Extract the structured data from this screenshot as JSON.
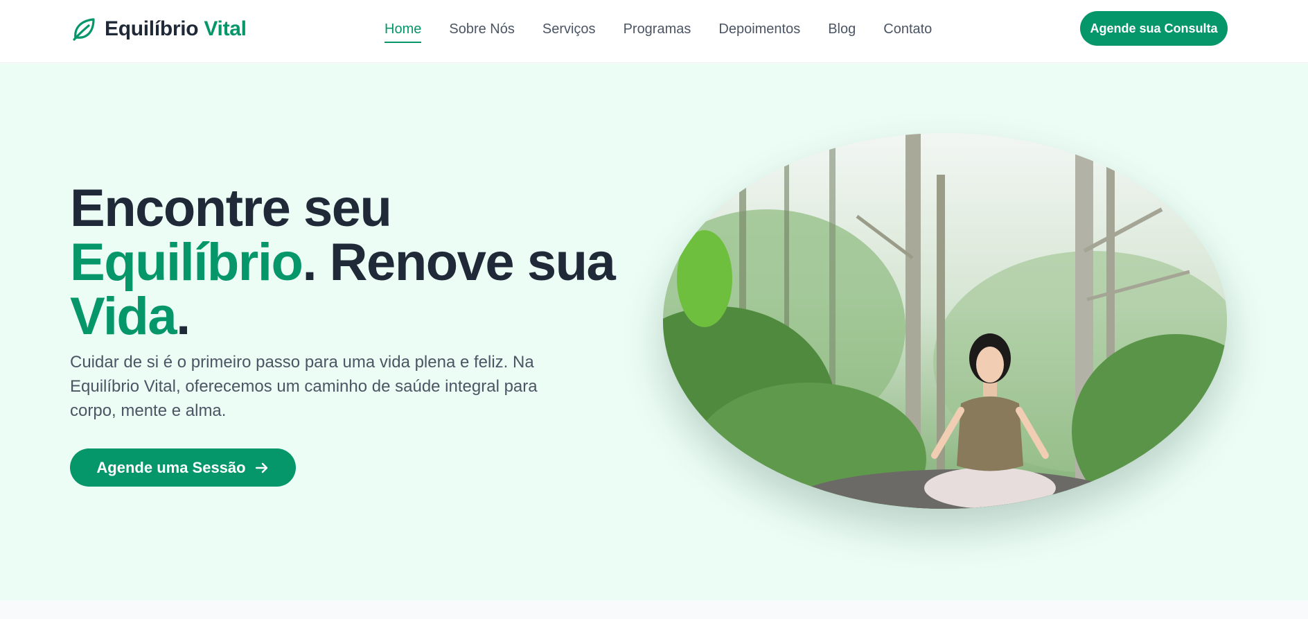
{
  "brand": {
    "name_part1": "Equilíbrio",
    "name_part2": "Vital",
    "icon": "leaf-icon",
    "color": "#059669"
  },
  "nav": {
    "links": [
      {
        "label": "Home",
        "active": true
      },
      {
        "label": "Sobre Nós",
        "active": false
      },
      {
        "label": "Serviços",
        "active": false
      },
      {
        "label": "Programas",
        "active": false
      },
      {
        "label": "Depoimentos",
        "active": false
      },
      {
        "label": "Blog",
        "active": false
      },
      {
        "label": "Contato",
        "active": false
      }
    ],
    "cta_label": "Agende sua Consulta"
  },
  "hero": {
    "title_line1": "Encontre seu",
    "title_accent1": "Equilíbrio",
    "title_mid": ". Renove sua",
    "title_accent2": "Vida",
    "title_end": ".",
    "description": "Cuidar de si é o primeiro passo para uma vida plena e feliz. Na Equilíbrio Vital, oferecemos um caminho de saúde integral para corpo, mente e alma.",
    "cta_label": "Agende uma Sessão",
    "cta_icon": "arrow-right-icon"
  },
  "colors": {
    "accent": "#059669",
    "dark_text": "#1f2937",
    "body_text": "#4b5563",
    "hero_bg": "#ecfdf5"
  }
}
